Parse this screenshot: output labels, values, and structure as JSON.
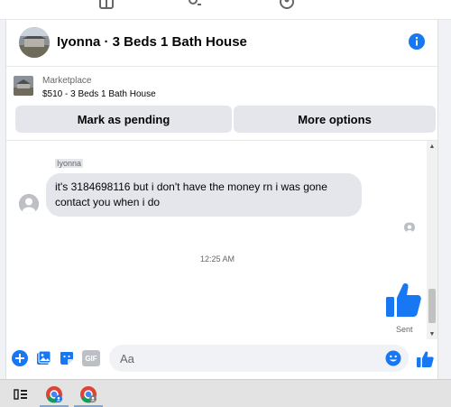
{
  "header": {
    "title": "Iyonna · 3 Beds 1 Bath House"
  },
  "listing": {
    "category": "Marketplace",
    "price_title": "$510 - 3 Beds 1 Bath House",
    "mark_pending_label": "Mark as pending",
    "more_options_label": "More options"
  },
  "chat": {
    "sender_name": "Iyonna",
    "message_text": "it's 3184698116 but i don't have the money rn i was gone contact you when i do",
    "timestamp": "12:25 AM",
    "sent_status": "Sent"
  },
  "composer": {
    "placeholder": "Aa",
    "gif_label": "GIF"
  },
  "colors": {
    "accent": "#1877f2",
    "bubble_bg": "#e4e6eb",
    "muted_text": "#65676b"
  }
}
